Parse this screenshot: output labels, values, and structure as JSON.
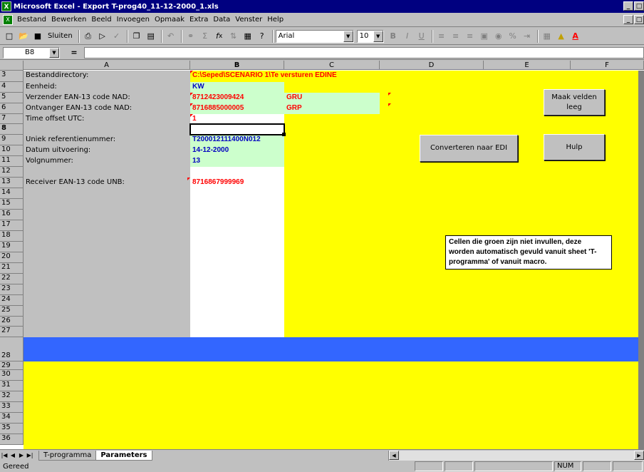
{
  "app": {
    "title": "Microsoft Excel - Export T-prog40_11-12-2000_1.xls",
    "window_buttons": [
      "_",
      "□",
      "×"
    ]
  },
  "menu": [
    "Bestand",
    "Bewerken",
    "Beeld",
    "Invoegen",
    "Opmaak",
    "Extra",
    "Data",
    "Venster",
    "Help"
  ],
  "toolbar": {
    "sluiten_label": "Sluiten",
    "font_name": "Arial",
    "font_size": "10",
    "bold": "B",
    "italic": "I",
    "underline": "U"
  },
  "formula": {
    "name_box": "B8",
    "equals": "=",
    "content": ""
  },
  "columns": [
    "A",
    "B",
    "C",
    "D",
    "E",
    "F"
  ],
  "rows": [
    "3",
    "4",
    "5",
    "6",
    "7",
    "8",
    "9",
    "10",
    "11",
    "12",
    "13",
    "14",
    "15",
    "16",
    "17",
    "18",
    "19",
    "20",
    "21",
    "22",
    "23",
    "24",
    "25",
    "26",
    "27",
    "28",
    "29",
    "30",
    "31",
    "32",
    "33",
    "34",
    "35",
    "36"
  ],
  "cells": {
    "a3": "Bestanddirectory:",
    "b3": "C:\\Seped\\SCENARIO 1\\Te versturen EDINE",
    "a4": "Eenheid:",
    "b4": "KW",
    "a5": "Verzender EAN-13 code NAD:",
    "b5": "8712423009424",
    "c5": "GRU",
    "a6": "Ontvanger EAN-13 code NAD:",
    "b6": "8716885000005",
    "c6": "GRP",
    "a7": "Time offset UTC:",
    "b7": "1",
    "a9": "Uniek referentienummer:",
    "b9": "T200012111400N012",
    "a10": "Datum uitvoering:",
    "b10": "14-12-2000",
    "a11": "Volgnummer:",
    "b11": "13",
    "a13": "Receiver EAN-13 code UNB:",
    "b13": "8716867999969"
  },
  "buttons": {
    "clear_fields": "Maak velden leeg",
    "convert": "Converteren naar EDI",
    "help": "Hulp"
  },
  "note": "Cellen die groen zijn niet invullen, deze worden automatisch gevuld vanuit sheet 'T-programma' of vanuit macro.",
  "sheets": [
    "T-programma",
    "Parameters"
  ],
  "active_sheet": "Parameters",
  "status": {
    "text": "Gereed",
    "num": "NUM"
  },
  "colors": {
    "yellow": "#ffff00",
    "green_input": "#ccffcc",
    "blue_band": "#3366ff",
    "label_gray": "#c0c0c0",
    "red_text": "#ff0000",
    "blue_text": "#0000c0"
  }
}
